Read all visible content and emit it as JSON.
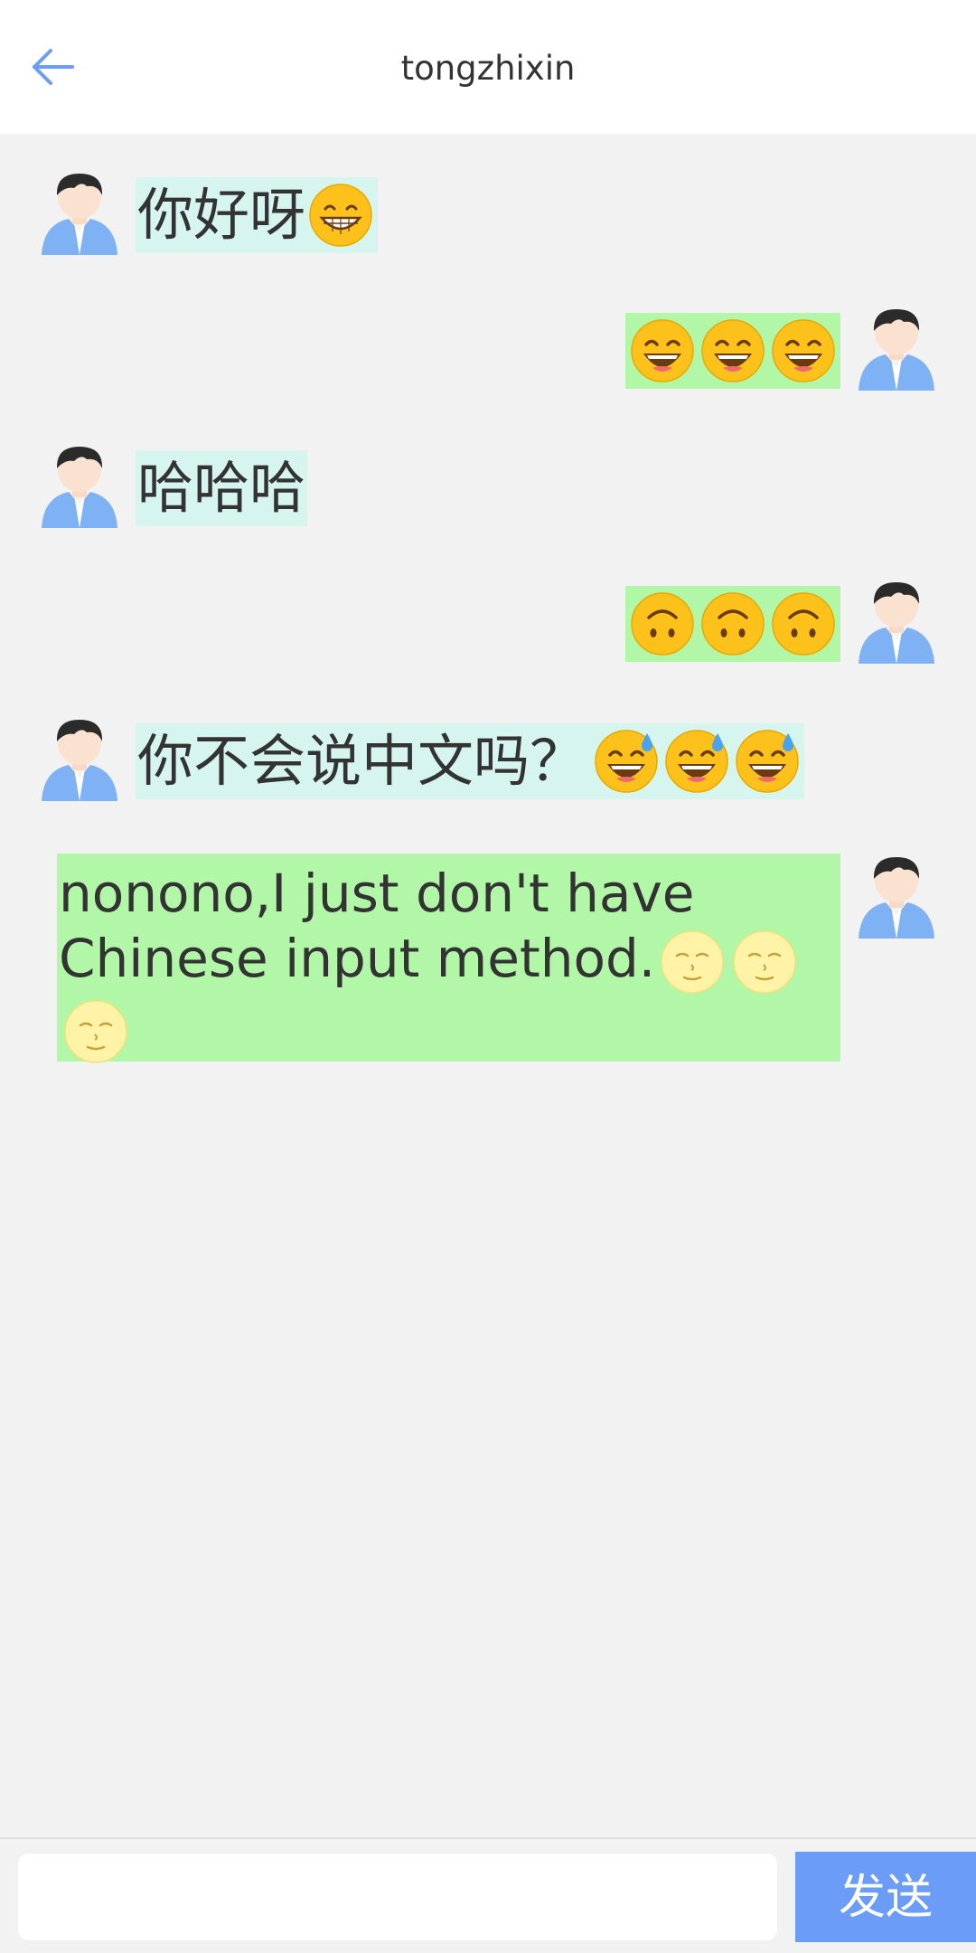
{
  "header": {
    "title": "tongzhixin",
    "back_icon": "arrow-left-icon",
    "accent": "#6b9cf8"
  },
  "messages": [
    {
      "side": "incoming",
      "text": "你好呀",
      "emoji": [
        "grin-icon"
      ]
    },
    {
      "side": "outgoing",
      "text": "",
      "emoji": [
        "smile-open-icon",
        "smile-open-icon",
        "smile-open-icon"
      ]
    },
    {
      "side": "incoming",
      "text": "哈哈哈",
      "emoji": []
    },
    {
      "side": "outgoing",
      "text": "",
      "emoji": [
        "upside-down-face-icon",
        "upside-down-face-icon",
        "upside-down-face-icon"
      ]
    },
    {
      "side": "incoming",
      "text": "你不会说中文吗？",
      "emoji": [
        "sweat-smile-icon",
        "sweat-smile-icon",
        "sweat-smile-icon"
      ]
    },
    {
      "side": "outgoing",
      "text": "nonono,I just don't have Chinese input method.",
      "emoji": [
        "moon-face-icon",
        "moon-face-icon",
        "moon-face-icon"
      ]
    }
  ],
  "colors": {
    "incoming_bubble": "#d7f5ef",
    "outgoing_bubble": "#b2f6a8",
    "background": "#f2f2f2",
    "send_button": "#6b9cf8"
  },
  "input": {
    "value": "",
    "placeholder": "",
    "send_label": "发送"
  }
}
